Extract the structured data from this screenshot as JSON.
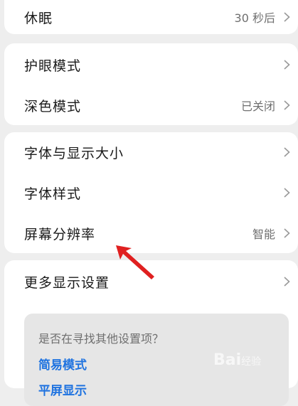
{
  "groups": [
    {
      "items": [
        {
          "label": "休眠",
          "value": "30 秒后",
          "icon": "chevron-right-icon"
        }
      ]
    },
    {
      "items": [
        {
          "label": "护眼模式",
          "value": "",
          "icon": "chevron-right-icon"
        },
        {
          "label": "深色模式",
          "value": "已关闭",
          "icon": "chevron-right-icon"
        }
      ]
    },
    {
      "items": [
        {
          "label": "字体与显示大小",
          "value": "",
          "icon": "chevron-right-icon"
        },
        {
          "label": "字体样式",
          "value": "",
          "icon": "chevron-right-icon"
        },
        {
          "label": "屏幕分辨率",
          "value": "智能",
          "icon": "chevron-right-icon"
        }
      ]
    },
    {
      "items": [
        {
          "label": "更多显示设置",
          "value": "",
          "icon": "chevron-right-icon"
        }
      ]
    }
  ],
  "suggestions": {
    "title": "是否在寻找其他设置项？",
    "links": [
      "简易模式",
      "平屏显示"
    ]
  },
  "annotation": {
    "color": "#e02020"
  },
  "watermark": {
    "text": "Bai",
    "subtext": "经验"
  },
  "colors": {
    "background": "#eeeeee",
    "card": "#ffffff",
    "link": "#1f73e0",
    "secondary_text": "#6f6f6f"
  }
}
